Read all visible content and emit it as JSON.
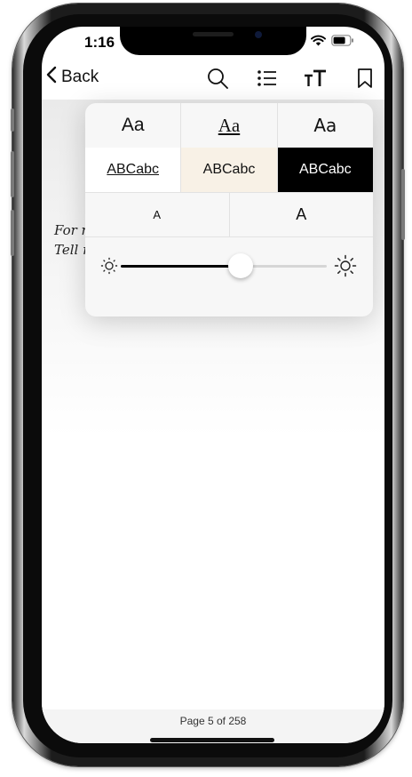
{
  "status": {
    "time": "1:16"
  },
  "nav": {
    "back_label": "Back"
  },
  "reader": {
    "lines": [
      "For r",
      "Tell r"
    ]
  },
  "appearance": {
    "fonts": [
      "Aa",
      "Aa",
      "Aa"
    ],
    "themes": [
      {
        "label": "ABCabc",
        "bg": "#ffffff",
        "fg": "#111111"
      },
      {
        "label": "ABCabc",
        "bg": "#f8f1e6",
        "fg": "#111111"
      },
      {
        "label": "ABCabc",
        "bg": "#000000",
        "fg": "#ffffff"
      }
    ],
    "size_smaller": "A",
    "size_larger": "A",
    "brightness_fraction": 0.58
  },
  "footer": {
    "page_label": "Page 5 of 258"
  }
}
